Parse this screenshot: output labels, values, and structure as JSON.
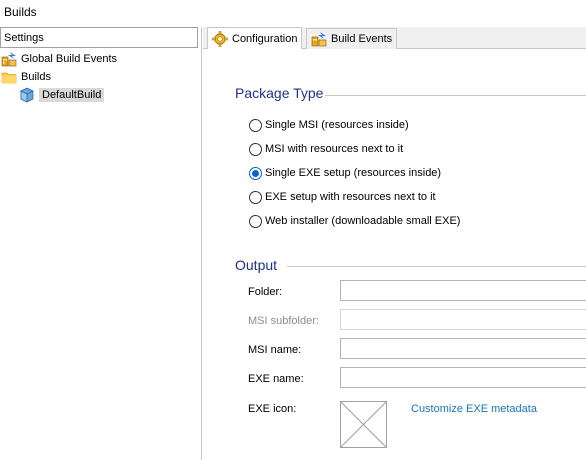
{
  "window": {
    "title": "Builds"
  },
  "settings_panel": {
    "header": "Settings",
    "tree": [
      {
        "label": "Global Build Events",
        "icon": "build-events-icon"
      },
      {
        "label": "Builds",
        "icon": "folder-icon"
      },
      {
        "label": "DefaultBuild",
        "icon": "build-package-icon",
        "selected": true
      }
    ]
  },
  "tabs": [
    {
      "label": "Configuration",
      "icon": "gear-icon",
      "active": true
    },
    {
      "label": "Build Events",
      "icon": "build-events-icon",
      "active": false
    }
  ],
  "package_type": {
    "title": "Package Type",
    "options": [
      {
        "label": "Single MSI (resources inside)",
        "checked": false
      },
      {
        "label": "MSI with resources next to it",
        "checked": false
      },
      {
        "label": "Single EXE setup (resources inside)",
        "checked": true
      },
      {
        "label": "EXE setup with resources next to it",
        "checked": false
      },
      {
        "label": "Web installer (downloadable small EXE)",
        "checked": false
      }
    ]
  },
  "output": {
    "title": "Output",
    "fields": [
      {
        "label": "Folder:",
        "value": "",
        "enabled": true
      },
      {
        "label": "MSI subfolder:",
        "value": "",
        "enabled": false
      },
      {
        "label": "MSI name:",
        "value": "",
        "enabled": true
      },
      {
        "label": "EXE name:",
        "value": "",
        "enabled": true
      }
    ],
    "exe_icon_label": "EXE icon:",
    "customize_link": "Customize EXE metadata"
  },
  "colors": {
    "group_title": "#1e3287",
    "link": "#1a73b5",
    "radio_checked": "#0a64c8",
    "selection": "#d9d9d9"
  }
}
